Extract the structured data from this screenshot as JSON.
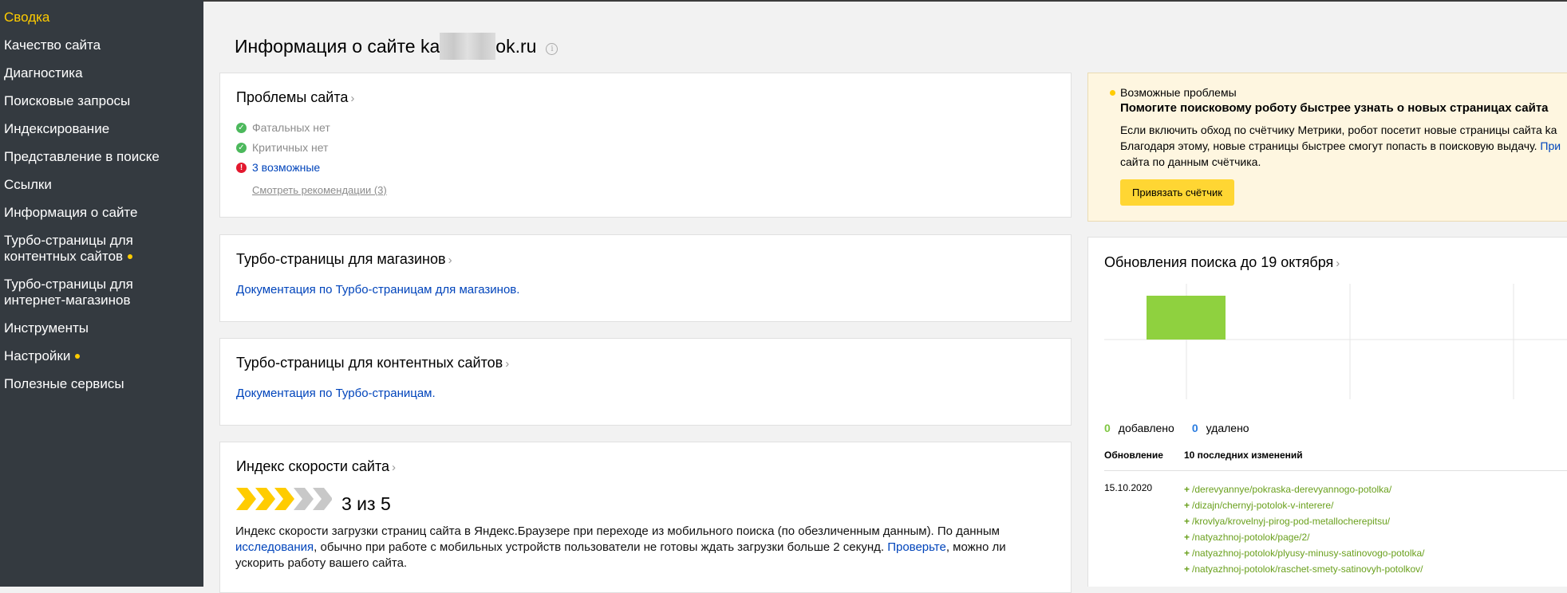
{
  "sidebar": {
    "items": [
      {
        "label": "Сводка",
        "active": true,
        "dot": false
      },
      {
        "label": "Качество сайта",
        "active": false,
        "dot": false
      },
      {
        "label": "Диагностика",
        "active": false,
        "dot": false
      },
      {
        "label": "Поисковые запросы",
        "active": false,
        "dot": false
      },
      {
        "label": "Индексирование",
        "active": false,
        "dot": false
      },
      {
        "label": "Представление в поиске",
        "active": false,
        "dot": false
      },
      {
        "label": "Ссылки",
        "active": false,
        "dot": false
      },
      {
        "label": "Информация о сайте",
        "active": false,
        "dot": false
      },
      {
        "label_line1": "Турбо-страницы для",
        "label_line2": "контентных сайтов",
        "active": false,
        "dot": true
      },
      {
        "label_line1": "Турбо-страницы для",
        "label_line2": "интернет-магазинов",
        "active": false,
        "dot": false
      },
      {
        "label": "Инструменты",
        "active": false,
        "dot": false
      },
      {
        "label": "Настройки",
        "active": false,
        "dot": true
      },
      {
        "label": "Полезные сервисы",
        "active": false,
        "dot": false
      }
    ]
  },
  "header": {
    "title_prefix": "Информация о сайте ka",
    "title_suffix": "ok.ru",
    "info_icon": "info-circle-icon"
  },
  "problems": {
    "title": "Проблемы сайта",
    "fatal": "Фатальных нет",
    "critical": "Критичных нет",
    "possible": "3 возможные",
    "recommendations": "Смотреть рекомендации (3)"
  },
  "turbo_shops": {
    "title": "Турбо-страницы для магазинов",
    "doc_link": "Документация по Турбо-страницам для магазинов."
  },
  "turbo_content": {
    "title": "Турбо-страницы для контентных сайтов",
    "doc_link": "Документация по Турбо-страницам."
  },
  "speed": {
    "title": "Индекс скорости сайта",
    "score": 3,
    "max": 5,
    "score_text": "3 из 5",
    "desc_part1": "Индекс скорости загрузки страниц сайта в Яндекс.Браузере при переходе из мобильного поиска (по обезличенным данным). По данным ",
    "desc_link1": "исследования",
    "desc_part2": ", обычно при работе с мобильных устройств пользователи не готовы ждать загрузки больше 2 секунд. ",
    "desc_link2": "Проверьте",
    "desc_part3": ", можно ли ускорить работу вашего сайта."
  },
  "notice": {
    "kicker": "Возможные проблемы",
    "title": "Помогите поисковому роботу быстрее узнать о новых страницах сайта",
    "body_line1": "Если включить обход по счётчику Метрики, робот посетит новые страницы сайта ka",
    "body_line2_text": "Благодаря этому, новые страницы быстрее смогут попасть в поисковую выдачу. ",
    "body_line2_link": "При",
    "body_line3": "сайта по данным счётчика.",
    "button": "Привязать счётчик"
  },
  "updates": {
    "title": "Обновления поиска до 19 октября",
    "added_count": "0",
    "added_label": "добавлено",
    "removed_count": "0",
    "removed_label": "удалено",
    "col_update": "Обновление",
    "col_changes": "10 последних изменений",
    "date": "15.10.2020",
    "changes": [
      "/derevyannye/pokraska-derevyannogo-potolka/",
      "/dizajn/chernyj-potolok-v-interere/",
      "/krovlya/krovelnyj-pirog-pod-metallocherepitsu/",
      "/natyazhnoj-potolok/page/2/",
      "/natyazhnoj-potolok/plyusy-minusy-satinovogo-potolka/",
      "/natyazhnoj-potolok/raschet-smety-satinovyh-potolkov/"
    ]
  },
  "chart_data": {
    "type": "bar",
    "series": [
      {
        "values": [
          1
        ]
      }
    ],
    "colors": {
      "bar": "#8fd13f",
      "grid": "#e6e6e6"
    }
  },
  "colors": {
    "sidebar_bg": "#343a40",
    "active": "#ffcc00",
    "link": "#0044bb",
    "ok": "#4cb85c",
    "error": "#e3182e",
    "added": "#7fc742",
    "removed": "#2b7de0"
  }
}
